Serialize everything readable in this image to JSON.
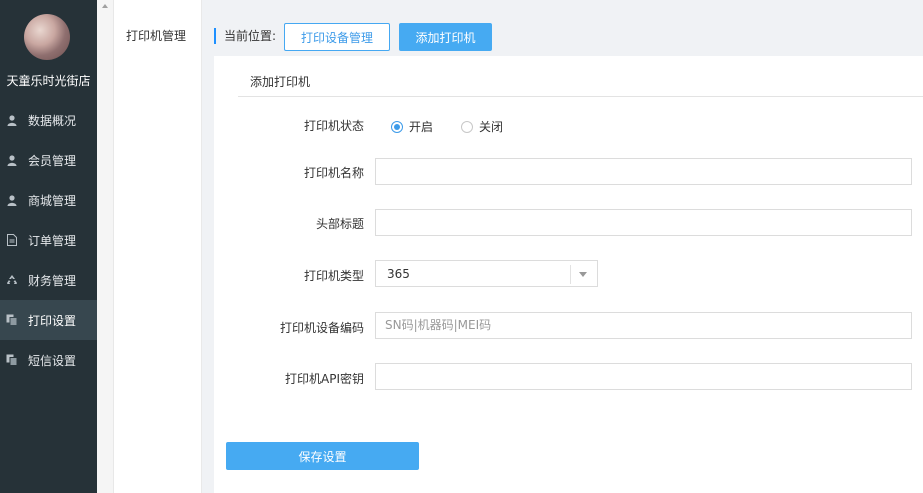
{
  "sidebar": {
    "store_name": "天童乐时光街店",
    "items": [
      {
        "label": "数据概况",
        "icon": "user-icon"
      },
      {
        "label": "会员管理",
        "icon": "user-icon"
      },
      {
        "label": "商城管理",
        "icon": "user-icon"
      },
      {
        "label": "订单管理",
        "icon": "document-icon"
      },
      {
        "label": "财务管理",
        "icon": "recycle-icon"
      },
      {
        "label": "打印设置",
        "icon": "copy-icon",
        "active": true
      },
      {
        "label": "短信设置",
        "icon": "copy-icon"
      }
    ]
  },
  "subnav": {
    "item": "打印机管理"
  },
  "breadcrumb": {
    "label": "当前位置:"
  },
  "toolbar": {
    "manage_label": "打印设备管理",
    "add_label": "添加打印机"
  },
  "panel": {
    "title": "添加打印机"
  },
  "form": {
    "status_label": "打印机状态",
    "status_on": "开启",
    "status_off": "关闭",
    "status_value": "开启",
    "name_label": "打印机名称",
    "name_value": "",
    "header_label": "头部标题",
    "header_value": "",
    "type_label": "打印机类型",
    "type_value": "365",
    "code_label": "打印机设备编码",
    "code_placeholder": "SN码|机器码|MEI码",
    "api_label": "打印机API密钥",
    "api_value": "",
    "save_label": "保存设置"
  },
  "colors": {
    "sidebar_bg": "#263238",
    "accent": "#46aaf2"
  }
}
